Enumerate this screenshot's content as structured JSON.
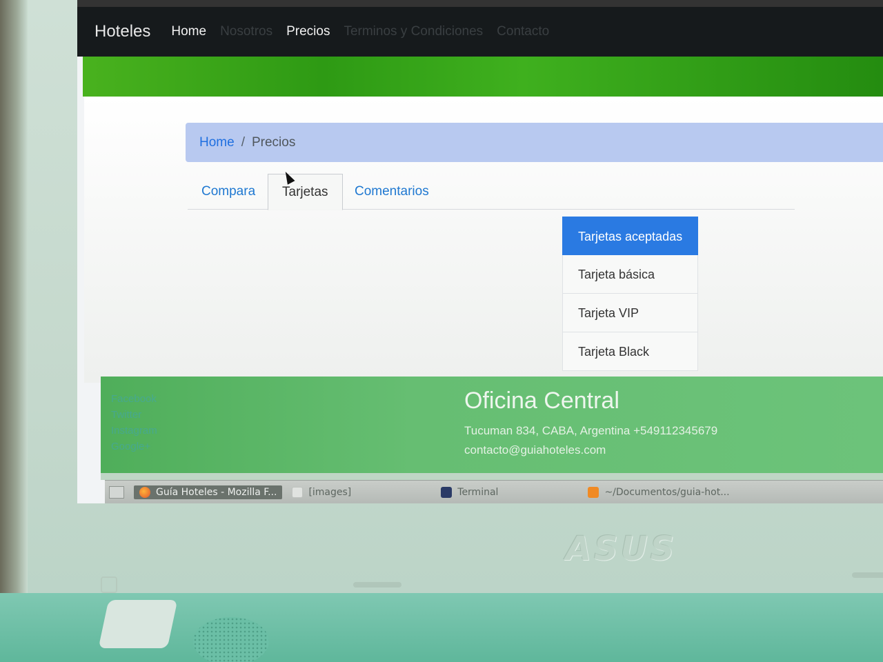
{
  "navbar": {
    "brand": "Hoteles",
    "links": [
      {
        "label": "Home",
        "state": "visible"
      },
      {
        "label": "Nosotros",
        "state": "dim"
      },
      {
        "label": "Precios",
        "state": "visible"
      },
      {
        "label": "Terminos y Condiciones",
        "state": "dim"
      },
      {
        "label": "Contacto",
        "state": "dim"
      }
    ]
  },
  "breadcrumb": {
    "home": "Home",
    "separator": "/",
    "current": "Precios"
  },
  "tabs": [
    {
      "label": "Compara"
    },
    {
      "label": "Tarjetas",
      "active": true
    },
    {
      "label": "Comentarios"
    }
  ],
  "cards_list": {
    "items": [
      {
        "label": "Tarjetas aceptadas",
        "active": true
      },
      {
        "label": "Tarjeta básica"
      },
      {
        "label": "Tarjeta VIP"
      },
      {
        "label": "Tarjeta Black"
      }
    ]
  },
  "footer": {
    "social": [
      "Facebook",
      "Twitter",
      "Instagram",
      "Google+"
    ],
    "office_title": "Oficina Central",
    "address": "Tucuman 834, CABA, Argentina +549112345679",
    "email": "contacto@guiahoteles.com"
  },
  "taskbar": {
    "items": [
      {
        "label": "Guía Hoteles - Mozilla F...",
        "icon": "firefox-icon",
        "active": true
      },
      {
        "label": "[images]",
        "icon": "folder-icon"
      },
      {
        "label": "Terminal",
        "icon": "terminal-icon"
      },
      {
        "label": "~/Documentos/guia-hot...",
        "icon": "sublime-icon"
      }
    ]
  },
  "device": {
    "brand": "ASUS"
  },
  "colors": {
    "navbar_bg": "#161a1c",
    "hero_green": "#3fb01e",
    "breadcrumb_bg": "#b8c9f0",
    "link_blue": "#1f78d1",
    "list_active": "#2a7ae2",
    "footer_green": "#66be72"
  }
}
